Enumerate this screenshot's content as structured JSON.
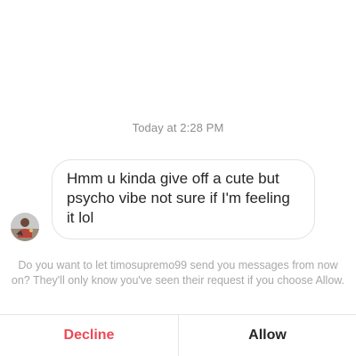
{
  "conversation": {
    "timestamp": "Today at 2:28 PM",
    "message": {
      "text": "Hmm u kinda give off a cute but psycho vibe not sure if I'm feeling it lol",
      "avatar": "user-avatar-photo"
    }
  },
  "request": {
    "prompt": "Do you want to let timosupremo99 send you messages from now on? They'll only know you've seen their request if you choose Allow."
  },
  "actions": {
    "decline_label": "Decline",
    "allow_label": "Allow"
  },
  "colors": {
    "decline": "#ed4956",
    "allow": "#262626",
    "timestamp": "#8e8e8e",
    "prompt": "#a8a8a8",
    "bubble_border": "#e3e3e3"
  }
}
